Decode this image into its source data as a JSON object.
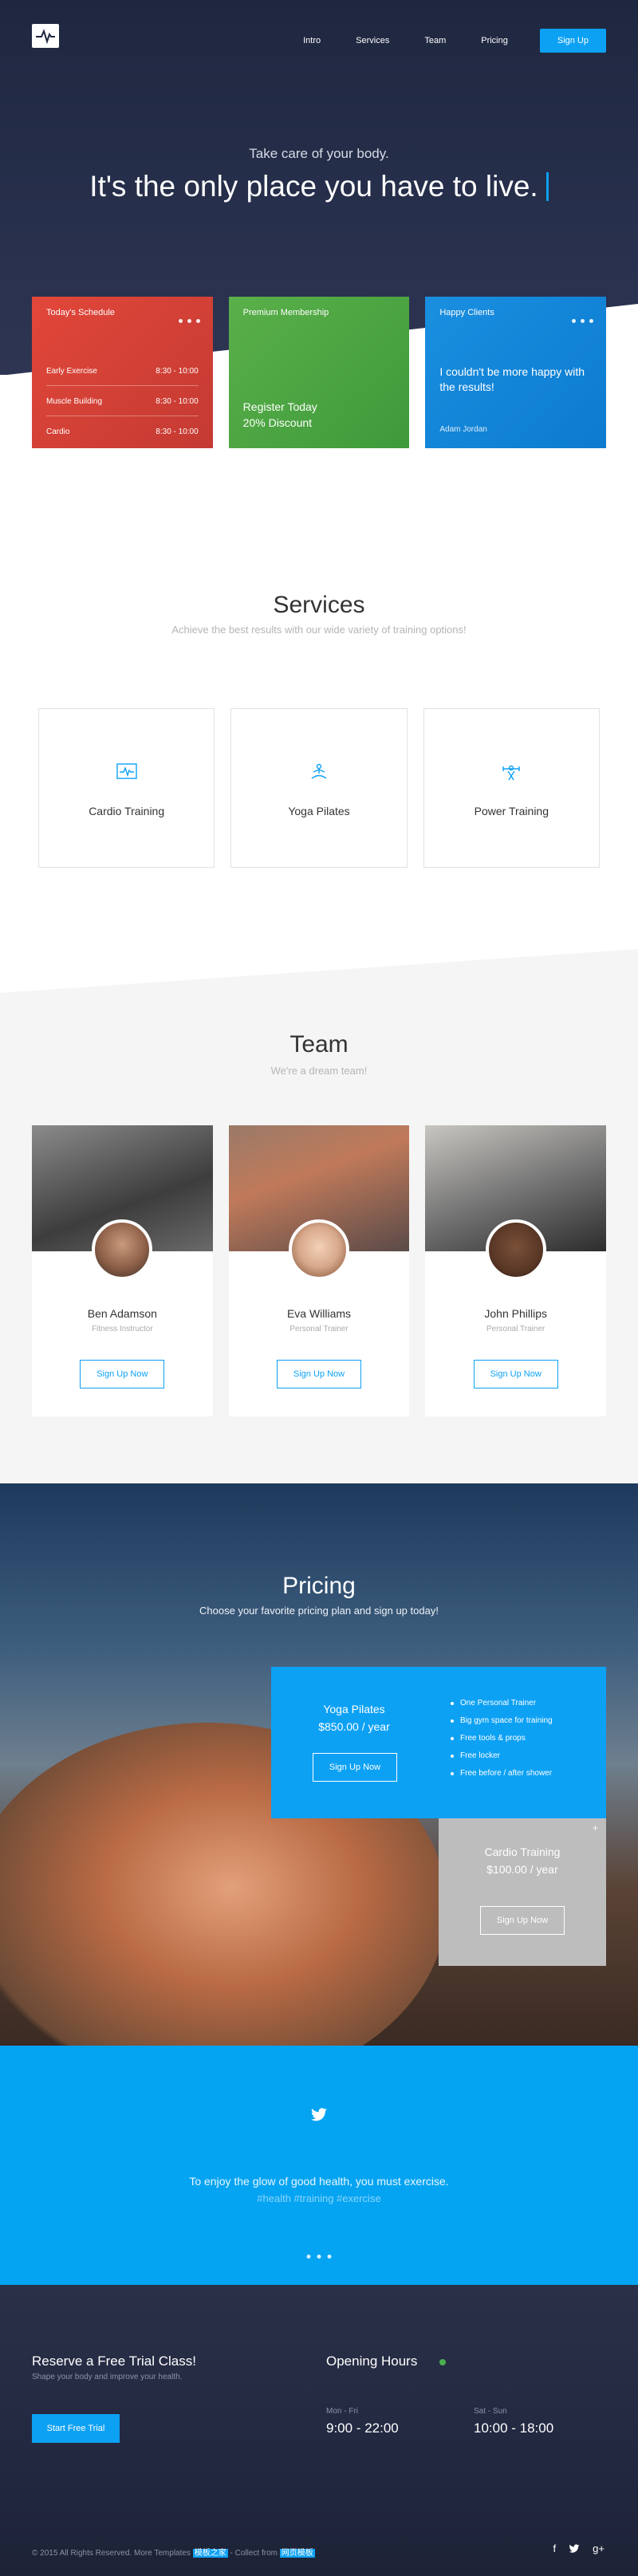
{
  "nav": {
    "links": [
      "Intro",
      "Services",
      "Team",
      "Pricing"
    ],
    "signup": "Sign Up"
  },
  "hero": {
    "subtitle": "Take care of your body.",
    "title": "It's the only place you have to live."
  },
  "cards": {
    "schedule": {
      "title": "Today's Schedule",
      "rows": [
        {
          "name": "Early Exercise",
          "time": "8:30 - 10:00"
        },
        {
          "name": "Muscle Building",
          "time": "8:30 - 10:00"
        },
        {
          "name": "Cardio",
          "time": "8:30 - 10:00"
        }
      ]
    },
    "membership": {
      "title": "Premium Membership",
      "line1": "Register Today",
      "line2": "20% Discount"
    },
    "clients": {
      "title": "Happy Clients",
      "quote": "I couldn't be more happy with the results!",
      "author": "Adam Jordan"
    }
  },
  "services": {
    "title": "Services",
    "subtitle": "Achieve the best results with our wide variety of training options!",
    "items": [
      {
        "name": "Cardio Training",
        "icon": "heart-monitor-icon"
      },
      {
        "name": "Yoga Pilates",
        "icon": "yoga-icon"
      },
      {
        "name": "Power Training",
        "icon": "dumbbell-icon"
      }
    ]
  },
  "team": {
    "title": "Team",
    "subtitle": "We're a dream team!",
    "button": "Sign Up Now",
    "members": [
      {
        "name": "Ben Adamson",
        "role": "Fitness Instructor"
      },
      {
        "name": "Eva Williams",
        "role": "Personal Trainer"
      },
      {
        "name": "John Phillips",
        "role": "Personal Trainer"
      }
    ]
  },
  "pricing": {
    "title": "Pricing",
    "subtitle": "Choose your favorite pricing plan and sign up today!",
    "plans": [
      {
        "name": "Yoga Pilates",
        "price": "$850.00 / year",
        "button": "Sign Up Now",
        "features": [
          "One Personal Trainer",
          "Big gym space for training",
          "Free tools & props",
          "Free locker",
          "Free before / after shower"
        ]
      },
      {
        "name": "Cardio Training",
        "price": "$100.00 / year",
        "button": "Sign Up Now"
      }
    ]
  },
  "testimonial": {
    "text": "To enjoy the glow of good health, you must exercise.",
    "tags": "#health #training #exercise"
  },
  "footer": {
    "trial_title": "Reserve a Free Trial Class!",
    "trial_sub": "Shape your body and improve your health.",
    "trial_button": "Start Free Trial",
    "hours_title": "Opening Hours",
    "hours": [
      {
        "days": "Mon - Fri",
        "time": "9:00 - 22:00"
      },
      {
        "days": "Sat - Sun",
        "time": "10:00 - 18:00"
      }
    ],
    "copyright": "© 2015 All Rights Reserved. More Templates",
    "link1": "模板之家",
    "collect": "- Collect from",
    "link2": "网页模板"
  },
  "colors": {
    "accent": "#0da1f4",
    "hero_bg": "#1f2740",
    "red_card": "#e2473a",
    "green_card": "#5ab04a",
    "blue_card": "#1a8fe0"
  }
}
